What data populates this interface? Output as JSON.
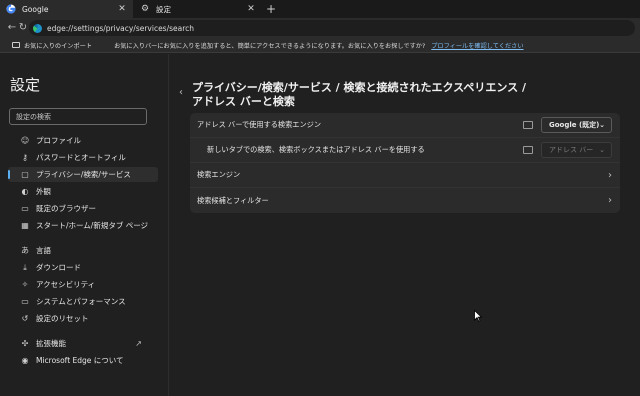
{
  "browser": {
    "tabs": [
      {
        "title": "Google",
        "active": true
      },
      {
        "title": "設定",
        "active": false
      }
    ],
    "url": "edge://settings/privacy/services/search",
    "favorites_bar": {
      "import_label": "お気に入りのインポート",
      "message": "お気に入りバーにお気に入りを追加すると、簡単にアクセスできるようになります。お気に入りをお探しですか?",
      "link": "プロフィールを確認してください"
    }
  },
  "sidebar": {
    "title": "設定",
    "search_placeholder": "設定の検索",
    "items": [
      {
        "label": "プロファイル",
        "icon": "person-icon"
      },
      {
        "label": "パスワードとオートフィル",
        "icon": "key-icon"
      },
      {
        "label": "プライバシー/検索/サービス",
        "icon": "lock-icon",
        "selected": true
      },
      {
        "label": "外観",
        "icon": "palette-icon"
      },
      {
        "label": "既定のブラウザー",
        "icon": "browser-icon"
      },
      {
        "label": "スタート/ホーム/新規タブ ページ",
        "icon": "home-icon"
      },
      {
        "label": "言語",
        "icon": "language-icon"
      },
      {
        "label": "ダウンロード",
        "icon": "download-icon"
      },
      {
        "label": "アクセシビリティ",
        "icon": "accessibility-icon"
      },
      {
        "label": "システムとパフォーマンス",
        "icon": "system-icon"
      },
      {
        "label": "設定のリセット",
        "icon": "reset-icon"
      },
      {
        "label": "拡張機能",
        "icon": "extensions-icon"
      },
      {
        "label": "Microsoft Edge について",
        "icon": "edge-icon"
      }
    ]
  },
  "main": {
    "heading_line1": "プライバシー/検索/サービス / 検索と接続されたエクスペリエンス /",
    "heading_line2": "アドレス バーと検索",
    "rows": [
      {
        "label": "アドレス バーで使用する検索エンジン",
        "dropdown": "Google (既定)"
      },
      {
        "label": "新しいタブでの検索、検索ボックスまたはアドレス バーを使用する",
        "dropdown": "アドレス バー"
      },
      {
        "label": "検索エンジン"
      },
      {
        "label": "検索候補とフィルター"
      }
    ]
  },
  "colors": {
    "accent": "#5ab0f2",
    "link": "#7fbdf2",
    "background": "#202020",
    "card": "#2b2b2b"
  }
}
